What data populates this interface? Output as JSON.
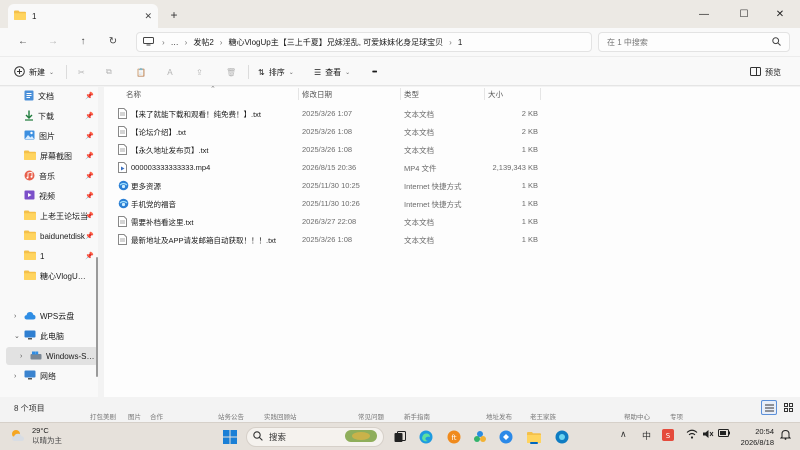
{
  "titlebar": {
    "tab_label": "1",
    "tab_close": "✕",
    "new_tab": "+",
    "minimize": "—",
    "maximize": "☐",
    "close": "✕"
  },
  "address": {
    "segments": [
      "…",
      "发帖2",
      "糖心VlogUp主【三上千夏】兄妹淫乱, 可爱妹妹化身足球宝贝",
      "1"
    ],
    "search_placeholder": "在 1 中搜索"
  },
  "commands": {
    "new_label": "新建",
    "sort_label": "排序",
    "view_label": "查看",
    "more_label": "•••",
    "preview_label": "预览"
  },
  "sidebar": {
    "items": [
      {
        "label": "文档",
        "pin": "📌"
      },
      {
        "label": "下载",
        "pin": "📌"
      },
      {
        "label": "图片",
        "pin": "📌"
      },
      {
        "label": "屏幕截图",
        "pin": "📌"
      },
      {
        "label": "音乐",
        "pin": "📌"
      },
      {
        "label": "视频",
        "pin": "📌"
      },
      {
        "label": "上老王论坛当",
        "pin": "📌"
      },
      {
        "label": "baidunetdisk",
        "pin": "📌"
      },
      {
        "label": "1",
        "pin": "📌"
      },
      {
        "label": "糖心VlogUp主",
        "pin": ""
      },
      {
        "label": "WPS云盘",
        "pin": ""
      },
      {
        "label": "此电脑",
        "pin": ""
      },
      {
        "label": "Windows-SSD",
        "pin": ""
      },
      {
        "label": "网络",
        "pin": ""
      }
    ]
  },
  "columns": {
    "name": "名称",
    "date": "修改日期",
    "type": "类型",
    "size": "大小"
  },
  "files": [
    {
      "name": "【来了就能下载和观看！纯免费！】.txt",
      "date": "2025/3/26 1:07",
      "type": "文本文档",
      "size": "2 KB",
      "icon": "text-file-icon"
    },
    {
      "name": "【论坛介绍】.txt",
      "date": "2025/3/26 1:08",
      "type": "文本文档",
      "size": "2 KB",
      "icon": "text-file-icon"
    },
    {
      "name": "【永久地址发布页】.txt",
      "date": "2025/3/26 1:08",
      "type": "文本文档",
      "size": "1 KB",
      "icon": "text-file-icon"
    },
    {
      "name": "000003333333333.mp4",
      "date": "2026/8/15 20:36",
      "type": "MP4 文件",
      "size": "2,139,343 KB",
      "icon": "video-file-icon"
    },
    {
      "name": "更多资源",
      "date": "2025/11/30 10:25",
      "type": "Internet 快捷方式",
      "size": "1 KB",
      "icon": "internet-shortcut-icon"
    },
    {
      "name": "手机党的福音",
      "date": "2025/11/30 10:26",
      "type": "Internet 快捷方式",
      "size": "1 KB",
      "icon": "internet-shortcut-icon"
    },
    {
      "name": "需要补档看这里.txt",
      "date": "2026/3/27 22:08",
      "type": "文本文档",
      "size": "1 KB",
      "icon": "text-file-icon"
    },
    {
      "name": "最新地址及APP请发邮箱自动获取！！！.txt",
      "date": "2025/3/26 1:08",
      "type": "文本文档",
      "size": "1 KB",
      "icon": "text-file-icon"
    }
  ],
  "status": {
    "count": "8 个项目"
  },
  "desktop_labels": [
    "打包美剧",
    "图片",
    "合作",
    "站务公告",
    "实践回顾站",
    "常见问题",
    "新手指南",
    "地址发布",
    "老王家族",
    "帮助中心",
    "专项"
  ],
  "taskbar": {
    "temperature": "29°C",
    "weather_desc": "以晴为主",
    "search_label": "搜索",
    "time": "20:54",
    "date": "2026/8/18",
    "tray_caret": "∧",
    "ime_label": "中"
  }
}
